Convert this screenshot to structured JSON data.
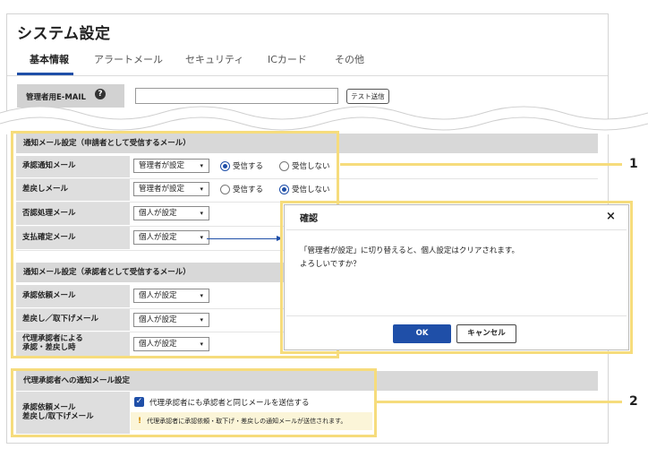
{
  "page": {
    "title": "システム設定"
  },
  "tabs": [
    {
      "label": "基本情報",
      "active": true
    },
    {
      "label": "アラートメール",
      "active": false
    },
    {
      "label": "セキュリティ",
      "active": false
    },
    {
      "label": "ICカード",
      "active": false
    },
    {
      "label": "その他",
      "active": false
    }
  ],
  "admin_email": {
    "label": "管理者用E-MAIL",
    "help_icon": "?",
    "value": "",
    "test_button": "テスト送信"
  },
  "applicant_section": {
    "header": "通知メール設定（申請者として受信するメール）",
    "rows": [
      {
        "label": "承認通知メール",
        "select": "管理者が設定",
        "radio": [
          "受信する",
          "受信しない"
        ],
        "selected": "受信する"
      },
      {
        "label": "差戻しメール",
        "select": "管理者が設定",
        "radio": [
          "受信する",
          "受信しない"
        ],
        "selected": "受信しない"
      },
      {
        "label": "否認処理メール",
        "select": "個人が設定"
      },
      {
        "label": "支払確定メール",
        "select": "個人が設定"
      }
    ]
  },
  "approver_section": {
    "header": "通知メール設定（承認者として受信するメール）",
    "rows": [
      {
        "label": "承認依頼メール",
        "select": "個人が設定"
      },
      {
        "label": "差戻し／取下げメール",
        "select": "個人が設定"
      },
      {
        "label_line1": "代理承認者による",
        "label_line2": "承認・差戻し時",
        "select": "個人が設定"
      }
    ]
  },
  "proxy_section": {
    "header": "代理承認者への通知メール設定",
    "label_line1": "承認依頼メール",
    "label_line2": "差戻し/取下げメール",
    "checkbox_label": "代理承認者にも承認者と同じメールを送信する",
    "checked": true,
    "notice": "代理承認者に承認依頼・取下げ・差戻しの通知メールが送信されます。",
    "notice_icon": "!"
  },
  "dialog": {
    "title": "確認",
    "close": "×",
    "message_line1": "「管理者が設定」に切り替えると、個人設定はクリアされます。",
    "message_line2": "よろしいですか？",
    "ok": "OK",
    "cancel": "キャンセル"
  },
  "callouts": [
    "1",
    "2"
  ],
  "colors": {
    "accent": "#1f4fa8",
    "highlight": "#f6dc7c",
    "section_bg": "#d8d8d8",
    "notice_bg": "#fbf5d8"
  },
  "icons": {
    "caret": "▾",
    "check": "✓"
  }
}
